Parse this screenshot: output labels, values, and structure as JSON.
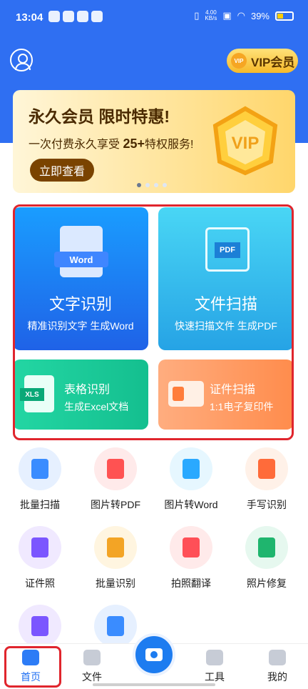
{
  "status_bar": {
    "time": "13:04",
    "net_speed_top": "4.00",
    "net_speed_bottom": "KB/s",
    "battery": "39%"
  },
  "header": {
    "vip_button_label": "VIP会员",
    "vip_badge": "VIP"
  },
  "banner": {
    "title": "永久会员 限时特惠!",
    "subtitle_prefix": "一次付费永久享受",
    "subtitle_highlight": "25+",
    "subtitle_suffix": "特权服务!",
    "cta": "立即查看",
    "page_count": 4,
    "active_page": 1
  },
  "feature_cards": {
    "text_recognition": {
      "icon_tag": "Word",
      "title": "文字识别",
      "subtitle": "精准识别文字 生成Word"
    },
    "file_scan": {
      "icon_tag": "PDF",
      "title": "文件扫描",
      "subtitle": "快速扫描文件 生成PDF"
    },
    "table_recognition": {
      "icon_tag": "XLS",
      "title": "表格识别",
      "subtitle": "生成Excel文档"
    },
    "id_scan": {
      "title": "证件扫描",
      "subtitle": "1:1电子复印件"
    }
  },
  "tools": [
    {
      "label": "批量扫描",
      "icon": "batch-scan-icon",
      "color": "blue"
    },
    {
      "label": "图片转PDF",
      "icon": "image-to-pdf-icon",
      "color": "red"
    },
    {
      "label": "图片转Word",
      "icon": "image-to-word-icon",
      "color": "cyan"
    },
    {
      "label": "手写识别",
      "icon": "handwriting-icon",
      "color": "orange"
    },
    {
      "label": "证件照",
      "icon": "id-photo-icon",
      "color": "purple"
    },
    {
      "label": "批量识别",
      "icon": "batch-recognition-icon",
      "color": "yellow"
    },
    {
      "label": "拍照翻译",
      "icon": "photo-translate-icon",
      "color": "pink"
    },
    {
      "label": "照片修复",
      "icon": "photo-restore-icon",
      "color": "green"
    }
  ],
  "tabbar": {
    "home": "首页",
    "files": "文件",
    "tools": "工具",
    "me": "我的"
  }
}
